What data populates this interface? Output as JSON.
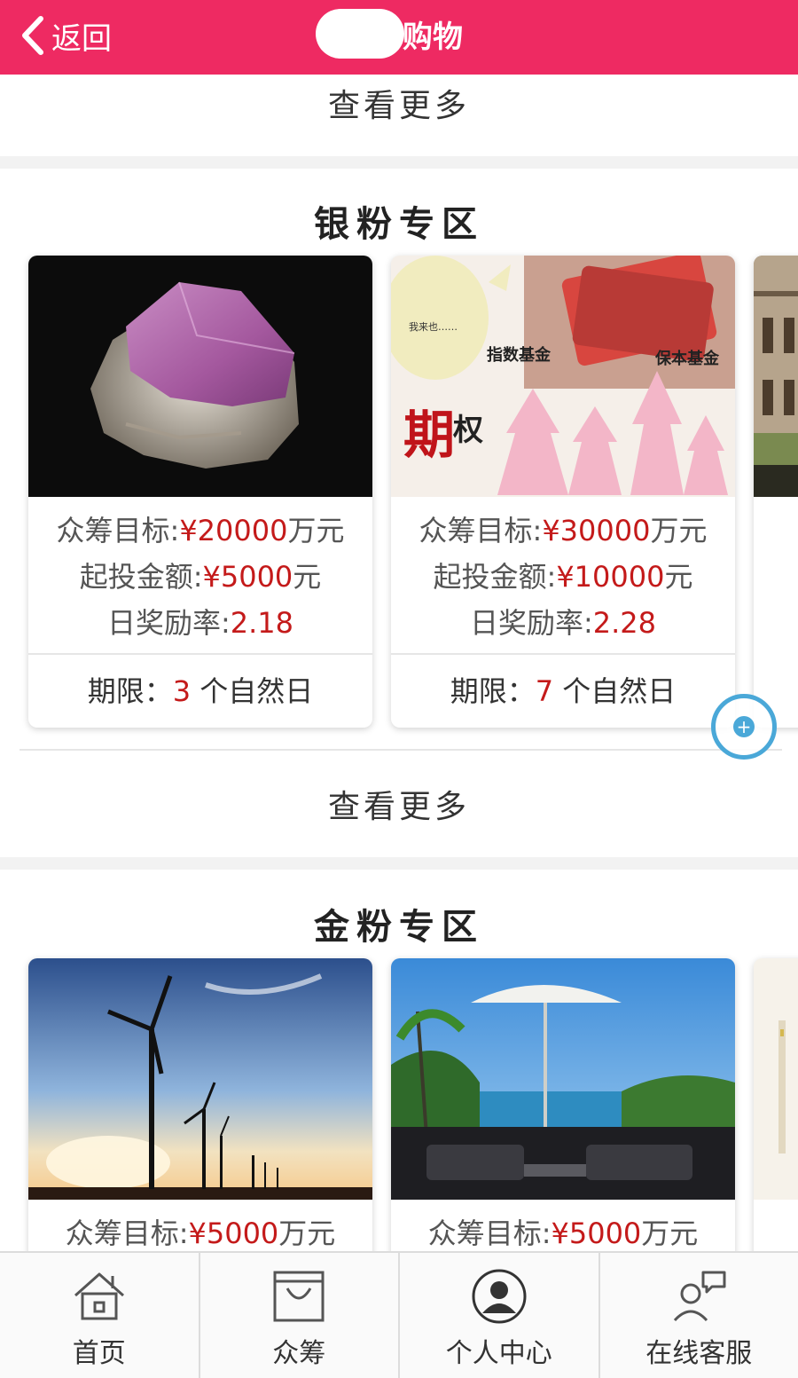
{
  "header": {
    "back_label": "返回",
    "title": "购物",
    "color": "#ee2a62"
  },
  "top_more": "查看更多",
  "sections": [
    {
      "title": "银粉专区",
      "cards": [
        {
          "image": "pink-crystal-mineral",
          "target_label": "众筹目标:",
          "target_value": "¥20000",
          "target_unit": "万元",
          "min_label": "起投金额:",
          "min_value": "¥5000",
          "min_unit": "元",
          "rate_label": "日奖励率:",
          "rate_value": "2.18",
          "term_label": "期限：",
          "term_value": "3",
          "term_unit": "个自然日"
        },
        {
          "image": "options-funds-money",
          "img_text_bubble": "我来也……",
          "img_text_1": "指数基金",
          "img_text_2": "保本基金",
          "img_text_3": "期",
          "img_text_4": "权",
          "target_label": "众筹目标:",
          "target_value": "¥30000",
          "target_unit": "万元",
          "min_label": "起投金额:",
          "min_value": "¥10000",
          "min_unit": "元",
          "rate_label": "日奖励率:",
          "rate_value": "2.28",
          "term_label": "期限：",
          "term_value": "7",
          "term_unit": "个自然日"
        }
      ],
      "more": "查看更多"
    },
    {
      "title": "金粉专区",
      "cards": [
        {
          "image": "wind-turbines-sunset",
          "target_label": "众筹目标:",
          "target_value": "¥5000",
          "target_unit": "万元"
        },
        {
          "image": "villa-pool-umbrella",
          "target_label": "众筹目标:",
          "target_value": "¥5000",
          "target_unit": "万元"
        }
      ]
    }
  ],
  "tabs": [
    {
      "label": "首页",
      "icon": "home-icon"
    },
    {
      "label": "众筹",
      "icon": "bag-icon"
    },
    {
      "label": "个人中心",
      "icon": "user-icon"
    },
    {
      "label": "在线客服",
      "icon": "support-chat-icon"
    }
  ],
  "accent_red": "#c41a1a",
  "float_button_color": "#4aa8d8"
}
